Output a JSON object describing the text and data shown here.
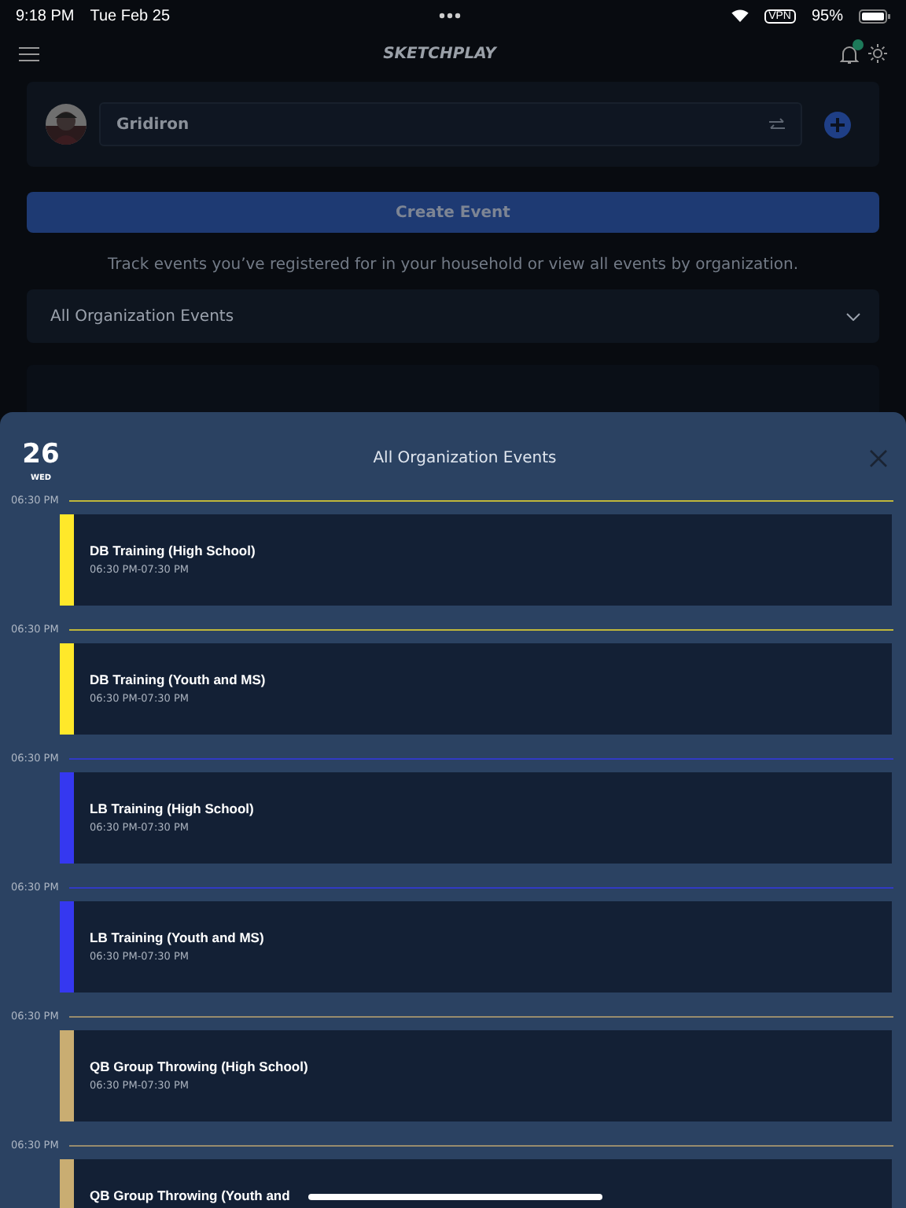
{
  "status_bar": {
    "time": "9:18 PM",
    "date": "Tue Feb 25",
    "battery": "95%",
    "vpn": "VPN"
  },
  "header": {
    "title": "SKETCHPLAY",
    "notification_dot": true
  },
  "profile": {
    "organization": "Gridiron"
  },
  "create_button": "Create Event",
  "description": "Track events you’ve registered for in your household or view all events by organization.",
  "filter": {
    "value": "All Organization Events"
  },
  "sheet": {
    "day": "26",
    "weekday": "WED",
    "title": "All Organization Events",
    "events": [
      {
        "slot": "06:30 PM",
        "title": "DB Training (High School)",
        "time": "06:30 PM-07:30 PM",
        "color": "#ffe82a"
      },
      {
        "slot": "06:30 PM",
        "title": "DB Training (Youth and MS)",
        "time": "06:30 PM-07:30 PM",
        "color": "#ffe82a"
      },
      {
        "slot": "06:30 PM",
        "title": "LB Training (High School)",
        "time": "06:30 PM-07:30 PM",
        "color": "#3538f0"
      },
      {
        "slot": "06:30 PM",
        "title": "LB Training (Youth and MS)",
        "time": "06:30 PM-07:30 PM",
        "color": "#3538f0"
      },
      {
        "slot": "06:30 PM",
        "title": "QB Group Throwing (High School)",
        "time": "06:30 PM-07:30 PM",
        "color": "#c9ad72"
      },
      {
        "slot": "06:30 PM",
        "title": "QB Group Throwing (Youth and",
        "color": "#c9ad72"
      }
    ]
  }
}
